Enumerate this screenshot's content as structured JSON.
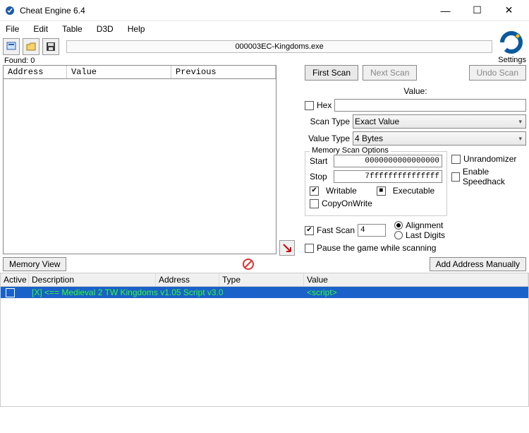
{
  "window": {
    "title": "Cheat Engine 6.4"
  },
  "menu": {
    "file": "File",
    "edit": "Edit",
    "table": "Table",
    "d3d": "D3D",
    "help": "Help"
  },
  "toolbar": {
    "process_label": "000003EC-Kingdoms.exe"
  },
  "found": {
    "label": "Found: 0"
  },
  "results": {
    "col_address": "Address",
    "col_value": "Value",
    "col_previous": "Previous"
  },
  "scan": {
    "first": "First Scan",
    "next": "Next Scan",
    "undo": "Undo Scan",
    "value_label": "Value:",
    "hex_label": "Hex",
    "value_input": "",
    "scan_type_label": "Scan Type",
    "scan_type_value": "Exact Value",
    "value_type_label": "Value Type",
    "value_type_value": "4 Bytes",
    "mem_options_label": "Memory Scan Options",
    "start_label": "Start",
    "start_value": "0000000000000000",
    "stop_label": "Stop",
    "stop_value": "7fffffffffffffff",
    "writable_label": "Writable",
    "executable_label": "Executable",
    "cow_label": "CopyOnWrite",
    "unrandomizer_label": "Unrandomizer",
    "speedhack_label": "Enable Speedhack",
    "fastscan_label": "Fast Scan",
    "fastscan_value": "4",
    "alignment_label": "Alignment",
    "lastdigits_label": "Last Digits",
    "pause_label": "Pause the game while scanning"
  },
  "mid": {
    "memory_view": "Memory View",
    "add_manual": "Add Address Manually"
  },
  "settings": {
    "label": "Settings"
  },
  "cheat": {
    "col_active": "Active",
    "col_desc": "Description",
    "col_addr": "Address",
    "col_type": "Type",
    "col_value": "Value",
    "rows": [
      {
        "desc": "[X] <== Medieval 2 TW Kingdoms v1.05 Script v3.0",
        "addr": "",
        "type": "",
        "value": "<script>"
      }
    ]
  }
}
